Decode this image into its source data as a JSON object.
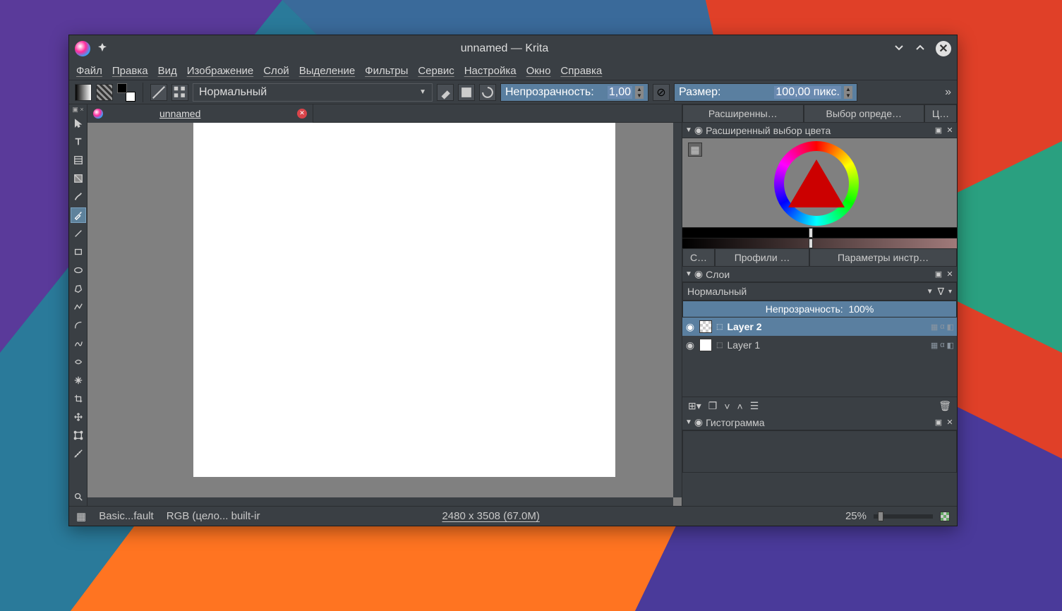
{
  "window": {
    "title": "unnamed  — Krita"
  },
  "menu": {
    "items": [
      "Файл",
      "Правка",
      "Вид",
      "Изображение",
      "Слой",
      "Выделение",
      "Фильтры",
      "Сервис",
      "Настройка",
      "Окно",
      "Справка"
    ]
  },
  "toolbar": {
    "blend_mode": "Нормальный",
    "opacity_label": "Непрозрачность:",
    "opacity_value": "1,00",
    "size_label": "Размер:",
    "size_value": "100,00 пикс."
  },
  "doc_tab": {
    "name": "unnamed"
  },
  "right_tabs_top": [
    "Расширенны…",
    "Выбор опреде…",
    "Ц…"
  ],
  "color_dock": {
    "title": "Расширенный выбор цвета"
  },
  "right_tabs_mid": [
    "С…",
    "Профили …",
    "Параметры инстр…"
  ],
  "layers_dock": {
    "title": "Слои",
    "blend_mode": "Нормальный",
    "opacity_label": "Непрозрачность:",
    "opacity_value": "100%",
    "layers": [
      {
        "name": "Layer 2",
        "selected": true,
        "checker": true
      },
      {
        "name": "Layer 1",
        "selected": false,
        "checker": false
      }
    ]
  },
  "histogram_dock": {
    "title": "Гистограмма"
  },
  "status": {
    "brush": "Basic...fault",
    "colorspace": "RGB (цело... built-ir",
    "dims": "2480 x 3508 (67.0M)",
    "zoom": "25%"
  },
  "tools": [
    "pointer",
    "text",
    "stamp",
    "gradient",
    "brush",
    "wand",
    "line",
    "rect",
    "ellipse",
    "poly",
    "polyline",
    "bezier",
    "freehand",
    "measure",
    "crop",
    "move",
    "zoom",
    "colorpick",
    "assist"
  ]
}
